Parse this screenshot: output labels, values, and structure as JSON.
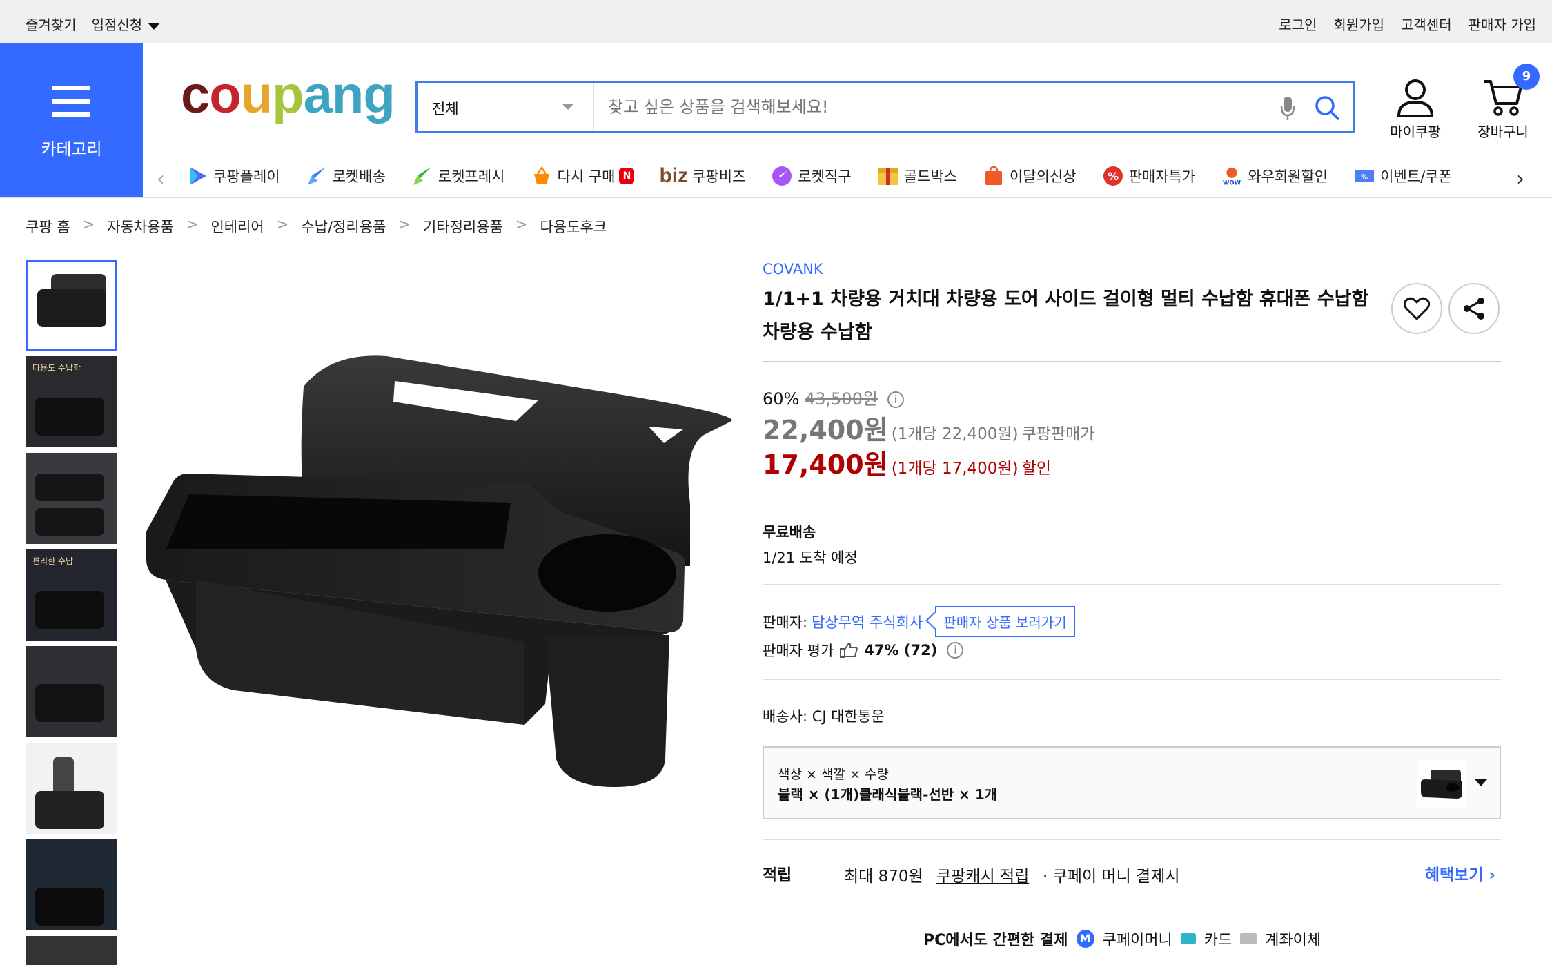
{
  "topbar": {
    "left": [
      "즐겨찾기",
      "입점신청"
    ],
    "right": [
      "로그인",
      "회원가입",
      "고객센터",
      "판매자 가입"
    ]
  },
  "category_button": {
    "label": "카테고리"
  },
  "logo": {
    "text": "coupang"
  },
  "search": {
    "category": "전체",
    "placeholder": "찾고 싶은 상품을 검색해보세요!"
  },
  "account": {
    "my_coupang": "마이쿠팡",
    "cart": "장바구니",
    "cart_count": "9"
  },
  "nav": {
    "items": [
      "쿠팡플레이",
      "로켓배송",
      "로켓프레시",
      "다시 구매",
      "쿠팡비즈",
      "로켓직구",
      "골드박스",
      "이달의신상",
      "판매자특가",
      "와우회원할인",
      "이벤트/쿠폰"
    ],
    "biz_prefix": "biz"
  },
  "breadcrumbs": [
    "쿠팡 홈",
    "자동차용품",
    "인테리어",
    "수납/정리용품",
    "기타정리용품",
    "다용도후크"
  ],
  "thumbnails": {
    "captions": [
      "",
      "다용도 수납함",
      "",
      "편리한 수납",
      "",
      "",
      "",
      ""
    ]
  },
  "product": {
    "brand": "COVANK",
    "title_line1": "1/1+1 차량용 거치대 차량용 도어 사이드 걸이형 멀티 수납함 휴대폰 수납함",
    "title_line2": "차량용 수납함",
    "discount_rate": "60%",
    "original_price": "43,500원",
    "price": "22,400원",
    "price_unit": "(1개당 22,400원)",
    "price_label": "쿠팡판매가",
    "sale_price": "17,400원",
    "sale_unit": "(1개당 17,400원)",
    "sale_label": "할인",
    "shipping_title": "무료배송",
    "arrival": "1/21 도착 예정",
    "seller_label": "판매자:",
    "seller_name": "담상무역 주식회사",
    "seller_more": "판매자 상품 보러가기",
    "rating_label": "판매자 평가",
    "rating_value": "47% (72)",
    "carrier_label": "배송사:",
    "carrier": "CJ 대한통운",
    "option_header": "색상 × 색깔 × 수량",
    "option_value": "블랙 × (1개)클래식블랙-선반 × 1개",
    "reward_title": "적립",
    "reward_max": "최대 870원",
    "reward_cash": "쿠팡캐시 적립",
    "reward_cond": "· 쿠페이 머니 결제시",
    "reward_more": "혜택보기 ›",
    "pay_title": "PC에서도 간편한 결제",
    "pay_money": "쿠페이머니",
    "pay_card": "카드",
    "pay_account": "계좌이체",
    "pay_money_badge": "M"
  },
  "colors": {
    "accent": "#346aff",
    "sale": "#ae0000"
  }
}
